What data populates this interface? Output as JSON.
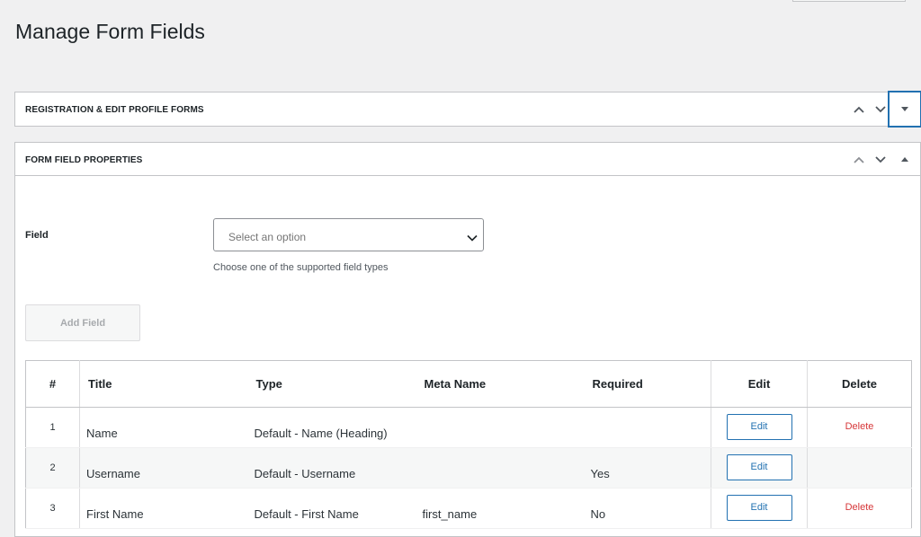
{
  "page": {
    "title": "Manage Form Fields"
  },
  "boxes": {
    "registration": {
      "title": "REGISTRATION & EDIT PROFILE FORMS"
    },
    "properties": {
      "title": "FORM FIELD PROPERTIES"
    }
  },
  "field_form": {
    "label": "Field",
    "select_placeholder": "Select an option",
    "help": "Choose one of the supported field types",
    "add_button": "Add Field"
  },
  "table": {
    "headers": {
      "num": "#",
      "title": "Title",
      "type": "Type",
      "meta": "Meta Name",
      "required": "Required",
      "edit": "Edit",
      "delete": "Delete"
    },
    "rows": [
      {
        "num": "1",
        "title": "Name",
        "type": "Default - Name (Heading)",
        "meta": "",
        "required": "",
        "edit": "Edit",
        "delete": "Delete"
      },
      {
        "num": "2",
        "title": "Username",
        "type": "Default - Username",
        "meta": "",
        "required": "Yes",
        "edit": "Edit",
        "delete": ""
      },
      {
        "num": "3",
        "title": "First Name",
        "type": "Default - First Name",
        "meta": "first_name",
        "required": "No",
        "edit": "Edit",
        "delete": "Delete"
      }
    ]
  },
  "colors": {
    "accent": "#2271b1",
    "danger": "#d63638",
    "background": "#f0f0f1"
  }
}
